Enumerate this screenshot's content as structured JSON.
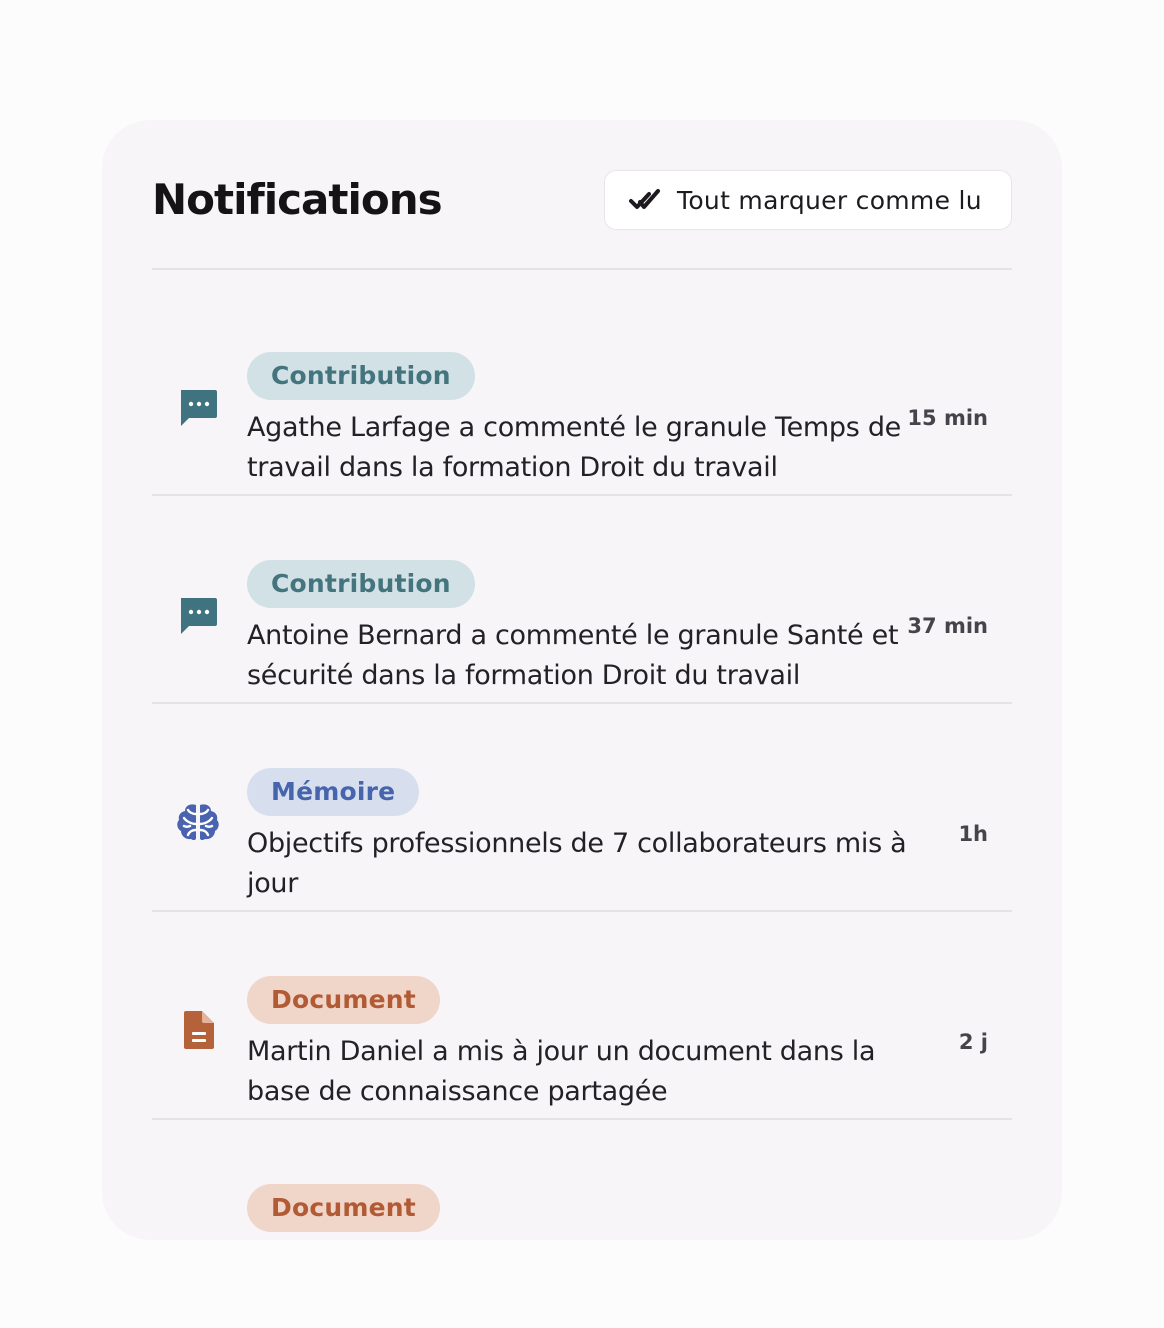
{
  "panel": {
    "title": "Notifications",
    "mark_all_read_label": "Tout marquer comme lu"
  },
  "notifications": [
    {
      "category": "Contribution",
      "icon": "comment-icon",
      "color": "#3f7380",
      "text": "Agathe Larfage a commenté le granule Temps de travail dans la formation Droit du travail",
      "time": "15 min"
    },
    {
      "category": "Contribution",
      "icon": "comment-icon",
      "color": "#3f7380",
      "text": "Antoine Bernard a commenté le granule Santé et sécurité dans la formation Droit du travail",
      "time": "37 min"
    },
    {
      "category": "Mémoire",
      "icon": "brain-icon",
      "color": "#4a63b0",
      "text": "Objectifs professionnels de 7 collaborateurs mis à jour",
      "time": "1h"
    },
    {
      "category": "Document",
      "icon": "document-icon",
      "color": "#b5623a",
      "text": "Martin Daniel a mis à jour un document dans la base de connaissance partagée",
      "time": "2 j"
    },
    {
      "category": "Document",
      "icon": "document-icon",
      "color": "#b5623a",
      "text": "",
      "time": ""
    }
  ]
}
